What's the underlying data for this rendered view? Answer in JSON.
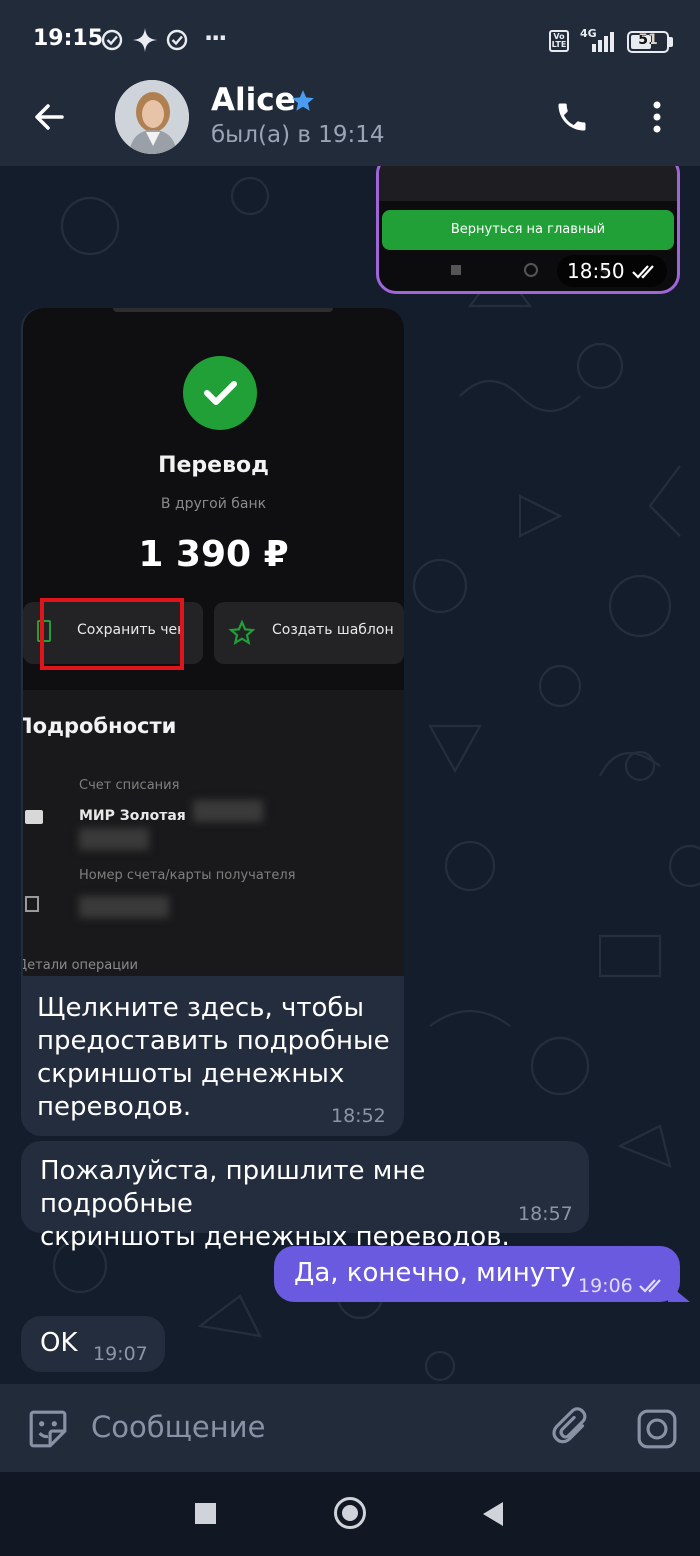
{
  "status_bar": {
    "time": "19:15",
    "network": "4G",
    "lte_badge": "Vo LTE",
    "battery": "51",
    "more": "···"
  },
  "header": {
    "contact_name": "Alice",
    "last_seen": "был(а) в 19:14",
    "icons": [
      "back-arrow-icon",
      "star-icon",
      "phone-icon",
      "more-vert-icon"
    ]
  },
  "messages": [
    {
      "direction": "outgoing",
      "type": "image",
      "image_button_label": "Вернуться на главный",
      "time": "18:50",
      "read": true
    },
    {
      "direction": "incoming",
      "type": "image_with_caption",
      "image": {
        "title": "Перевод",
        "subtitle": "В другой банк",
        "amount": "1 390 ₽",
        "btn_save": "Сохранить чек",
        "btn_template": "Создать шаблон",
        "details_title": "Подробности",
        "account_label": "Счет списания",
        "account_value": "МИР Золотая",
        "recipient_label": "Номер счета/карты получателя",
        "ops_label": "Детали операции"
      },
      "caption": "Щелкните здесь, чтобы предоставить подробные скриншоты денежных переводов.",
      "caption_lines": [
        "Щелкните здесь, чтобы",
        "предоставить подробные",
        "скриншоты денежных",
        "переводов."
      ],
      "time": "18:52"
    },
    {
      "direction": "incoming",
      "type": "text",
      "lines": [
        "Пожалуйста, пришлите мне подробные",
        "скриншоты денежных переводов."
      ],
      "time": "18:57"
    },
    {
      "direction": "outgoing",
      "type": "text",
      "text": "Да, конечно, минуту",
      "time": "19:06",
      "read": true
    },
    {
      "direction": "incoming",
      "type": "text",
      "text": "OK",
      "time": "19:07"
    }
  ],
  "input": {
    "placeholder": "Сообщение",
    "icons": [
      "sticker-icon",
      "attach-icon",
      "camera-icon"
    ]
  },
  "colors": {
    "header_bg": "#222b3a",
    "chat_bg": "#141d2c",
    "incoming_bubble": "#242d3d",
    "outgoing_bubble": "#6a5ae0",
    "accent_green": "#21a038",
    "highlight_red": "#e0141b",
    "star_blue": "#4a9cf0"
  }
}
